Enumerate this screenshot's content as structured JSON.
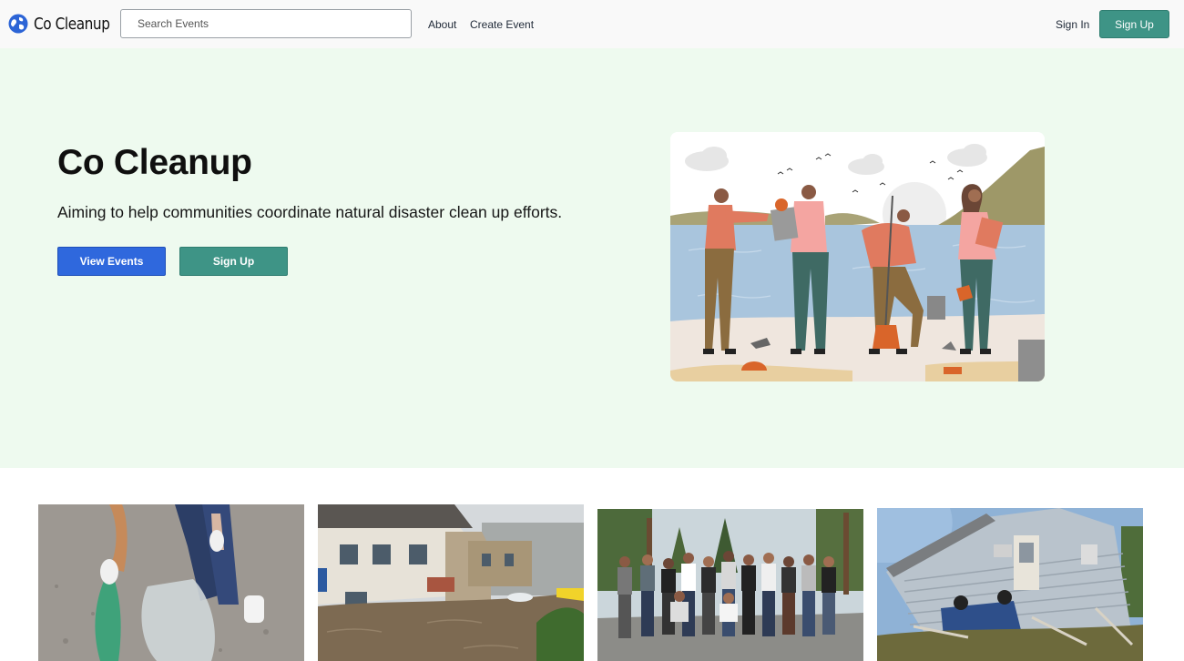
{
  "header": {
    "brand": "Co Cleanup",
    "search_placeholder": "Search Events",
    "nav": {
      "about": "About",
      "create_event": "Create Event"
    },
    "sign_in": "Sign In",
    "sign_up": "Sign Up"
  },
  "hero": {
    "title": "Co Cleanup",
    "subtitle": "Aiming to help communities coordinate natural disaster clean up efforts.",
    "view_events": "View Events",
    "sign_up": "Sign Up"
  },
  "colors": {
    "primary_blue": "#2f68dd",
    "accent_teal": "#3e9486",
    "hero_bg": "#eefaef"
  }
}
